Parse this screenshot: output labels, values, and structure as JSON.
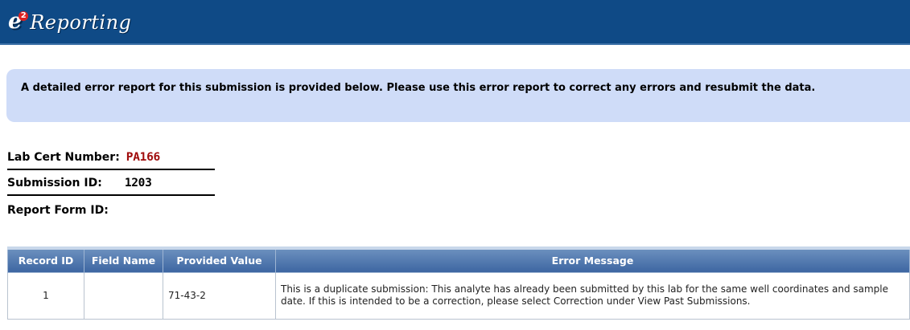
{
  "header": {
    "logo_letter": "e",
    "logo_superscript": "2",
    "logo_word": "Reporting"
  },
  "notice": {
    "text": "A detailed error report for this submission is provided below. Please use this error report to correct any errors and resubmit the data."
  },
  "info": {
    "lab_cert_label": "Lab Cert Number:",
    "lab_cert_value": "PA166",
    "submission_label": "Submission ID:",
    "submission_value": "1203",
    "report_form_label": "Report Form ID:",
    "report_form_value": ""
  },
  "table": {
    "headers": [
      "Record ID",
      "Field Name",
      "Provided Value",
      "Error Message"
    ],
    "rows": [
      {
        "record_id": "1",
        "field_name": "",
        "provided_value": "71-43-2",
        "error_message": "This is a duplicate submission: This analyte has already been submitted by this lab for the same well coordinates and sample date. If this is intended to be a correction, please select Correction under View Past Submissions."
      }
    ]
  },
  "colors": {
    "header_bg": "#0f4a86",
    "notice_bg": "#cfdcf8",
    "lab_cert_value": "#a00c0c",
    "table_header_bg": "#4d74ab"
  }
}
